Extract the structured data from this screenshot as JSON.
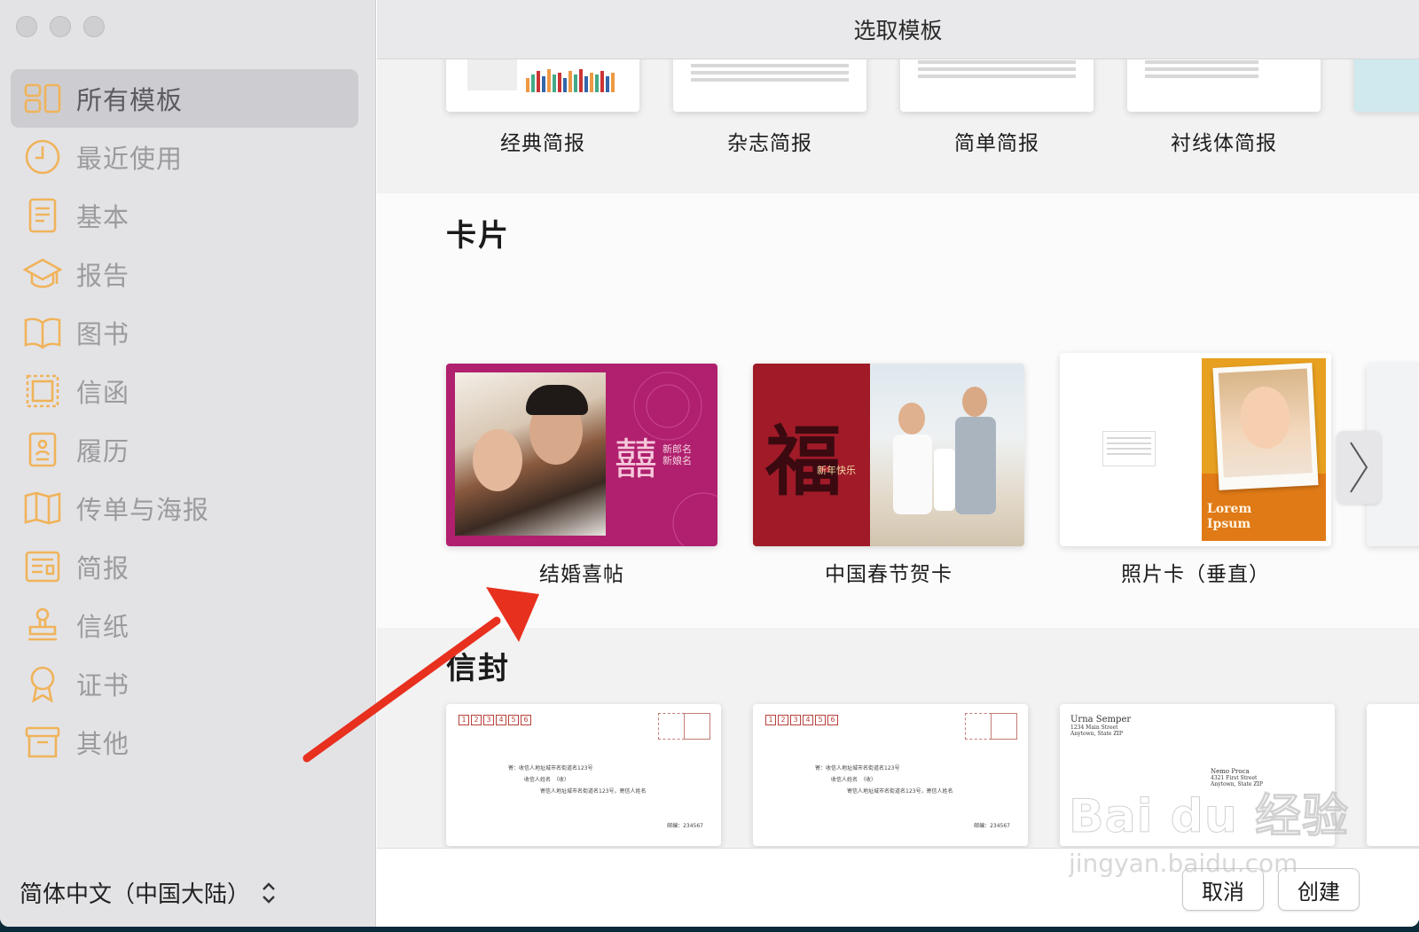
{
  "window": {
    "title": "选取模板"
  },
  "sidebar": {
    "items": [
      {
        "label": "所有模板",
        "icon": "grid-icon",
        "active": true
      },
      {
        "label": "最近使用",
        "icon": "clock-icon"
      },
      {
        "label": "基本",
        "icon": "document-icon"
      },
      {
        "label": "报告",
        "icon": "graduation-cap-icon"
      },
      {
        "label": "图书",
        "icon": "book-icon"
      },
      {
        "label": "信函",
        "icon": "stamp-frame-icon"
      },
      {
        "label": "履历",
        "icon": "resume-icon"
      },
      {
        "label": "传单与海报",
        "icon": "map-icon"
      },
      {
        "label": "简报",
        "icon": "newsletter-icon"
      },
      {
        "label": "信纸",
        "icon": "stamp-icon"
      },
      {
        "label": "证书",
        "icon": "ribbon-icon"
      },
      {
        "label": "其他",
        "icon": "archive-icon"
      }
    ],
    "language": "简体中文（中国大陆）"
  },
  "sections": {
    "newsletters": {
      "items": [
        "经典简报",
        "杂志简报",
        "简单简报",
        "衬线体简报"
      ]
    },
    "cards": {
      "title": "卡片",
      "items": [
        {
          "label": "结婚喜帖",
          "text1": "新郎名",
          "text2": "新娘名",
          "glyph": "囍"
        },
        {
          "label": "中国春节贺卡",
          "text1": "新年快乐",
          "glyph": "福"
        },
        {
          "label": "照片卡（垂直）",
          "text1": "Lorem",
          "text2": "Ipsum"
        }
      ]
    },
    "envelopes": {
      "title": "信封",
      "items": [
        {
          "zip": [
            "1",
            "2",
            "3",
            "4",
            "5",
            "6"
          ],
          "line1": "寄：收信人地址城市名街道名123号",
          "line2": "收信人姓名　（收）",
          "line3": "寄信人地址城市名街道名123号，寄信人姓名",
          "postcode": "邮编：234567"
        },
        {
          "zip": [
            "1",
            "2",
            "3",
            "4",
            "5",
            "6"
          ],
          "line1": "寄：收信人地址城市名街道名123号",
          "line2": "收信人姓名　（收）",
          "line3": "寄信人地址城市名街道名123号，寄信人姓名",
          "postcode": "邮编：234567"
        },
        {
          "name": "Urna Semper",
          "addr1": "1234 Main Street",
          "addr2": "Anytown, State ZIP",
          "name2": "Nemo Proca",
          "addr3": "4321 First Street",
          "addr4": "Anytown, State ZIP"
        }
      ]
    }
  },
  "footer": {
    "cancel": "取消",
    "create": "创建"
  },
  "watermark": {
    "brand": "Bai du 经验",
    "url": "jingyan.baidu.com"
  },
  "colors": {
    "accent_icon": "#f0b35a",
    "arrow": "#e8301f",
    "wedding_bg": "#b0206e",
    "newyear_bg": "#a01a28",
    "photo_orange": "#e07a16"
  }
}
